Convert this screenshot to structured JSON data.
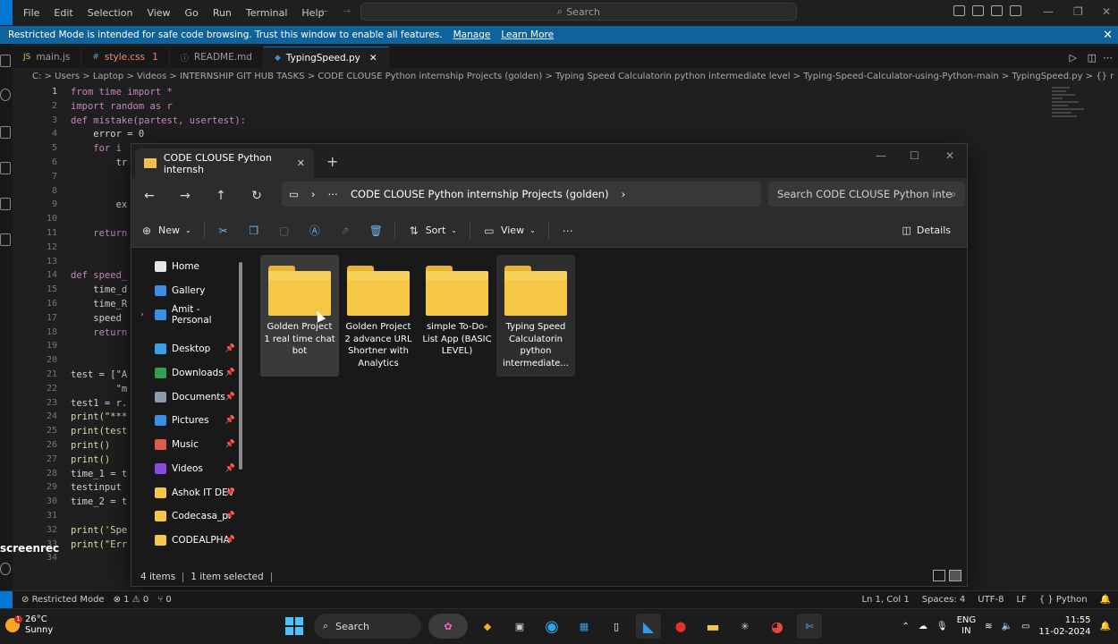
{
  "menubar": {
    "items": [
      "File",
      "Edit",
      "Selection",
      "View",
      "Go",
      "Run",
      "Terminal",
      "Help"
    ],
    "command_center": "Search"
  },
  "banner": {
    "text": "Restricted Mode is intended for safe code browsing. Trust this window to enable all features.",
    "manage": "Manage",
    "learn_more": "Learn More"
  },
  "tabs": [
    {
      "icon": "JS",
      "label": "main.js",
      "badge": ""
    },
    {
      "icon": "#",
      "label": "style.css",
      "badge": "1"
    },
    {
      "icon": "ⓘ",
      "label": "README.md",
      "badge": ""
    },
    {
      "icon": "◆",
      "label": "TypingSpeed.py",
      "badge": "",
      "active": true
    }
  ],
  "breadcrumb": "C: > Users > Laptop > Videos > INTERNSHIP GIT HUB TASKS > CODE CLOUSE Python internship Projects (golden) > Typing Speed Calculatorin python intermediate level > Typing-Speed-Calculator-using-Python-main > TypingSpeed.py > {} r",
  "code": {
    "line_numbers": [
      "1",
      "2",
      "3",
      "4",
      "5",
      "6",
      "7",
      "8",
      "9",
      "10",
      "11",
      "12",
      "13",
      "14",
      "15",
      "16",
      "17",
      "18",
      "19",
      "20",
      "21",
      "22",
      "23",
      "24",
      "25",
      "26",
      "27",
      "28",
      "29",
      "30",
      "31",
      "32",
      "33",
      "34"
    ],
    "lines": [
      "from time import *",
      "import random as r",
      "def mistake(partest, usertest):",
      "    error = 0",
      "    for i",
      "        tr",
      "",
      "",
      "        ex",
      "",
      "    return",
      "",
      "",
      "def speed_",
      "    time_d",
      "    time_R",
      "    speed",
      "    return",
      "",
      "",
      "test = [\"A",
      "        \"m",
      "test1 = r.",
      "print(\"***",
      "print(test",
      "print()",
      "print()",
      "time_1 = t",
      "testinput",
      "time_2 = t",
      "",
      "print('Spe",
      "print(\"Err",
      ""
    ]
  },
  "statusbar": {
    "restricted": "Restricted Mode",
    "problems": "⊗ 1 ⚠ 0",
    "ports": "⑂ 0",
    "position": "Ln 1, Col 1",
    "spaces": "Spaces: 4",
    "encoding": "UTF-8",
    "eol": "LF",
    "language": "Python"
  },
  "explorer": {
    "tab_title": "CODE CLOUSE Python internsh",
    "address": "CODE CLOUSE Python internship Projects (golden)",
    "search_placeholder": "Search CODE CLOUSE Python inte",
    "new_label": "New",
    "sort_label": "Sort",
    "view_label": "View",
    "details_label": "Details",
    "nav": [
      {
        "label": "Home",
        "pinned": false,
        "color": "#e6e6e6"
      },
      {
        "label": "Gallery",
        "pinned": false,
        "color": "#3a8ee6"
      },
      {
        "label": "Amit - Personal",
        "pinned": false,
        "color": "#3a8ee6",
        "expandable": true
      },
      {
        "label": "Desktop",
        "pinned": true,
        "color": "#3aa0e6"
      },
      {
        "label": "Downloads",
        "pinned": true,
        "color": "#2ea04f"
      },
      {
        "label": "Documents",
        "pinned": true,
        "color": "#8a9bb0"
      },
      {
        "label": "Pictures",
        "pinned": true,
        "color": "#3a8ee6"
      },
      {
        "label": "Music",
        "pinned": true,
        "color": "#e05a4a"
      },
      {
        "label": "Videos",
        "pinned": true,
        "color": "#8a4ae0"
      },
      {
        "label": "Ashok IT DEV",
        "pinned": true,
        "color": "#f5c744"
      },
      {
        "label": "Codecasa_pr",
        "pinned": true,
        "color": "#f5c744"
      },
      {
        "label": "CODEALPHA",
        "pinned": true,
        "color": "#f5c744"
      }
    ],
    "folders": [
      {
        "name": "Golden Project 1 real time chat bot",
        "selected": true
      },
      {
        "name": "Golden Project 2 advance URL Shortner with Analytics",
        "selected": false
      },
      {
        "name": "simple To-Do-List App (BASIC LEVEL)",
        "selected": false
      },
      {
        "name": "Typing Speed Calculatorin python intermediate...",
        "selected": false,
        "hover": true
      }
    ],
    "status_items": "4 items",
    "status_selected": "1 item selected"
  },
  "taskbar": {
    "temp": "26°C",
    "weather": "Sunny",
    "weather_badge": "1",
    "search": "Search",
    "lang1": "ENG",
    "lang2": "IN",
    "time": "11:55",
    "date": "11-02-2024"
  },
  "watermark": "screenrec"
}
